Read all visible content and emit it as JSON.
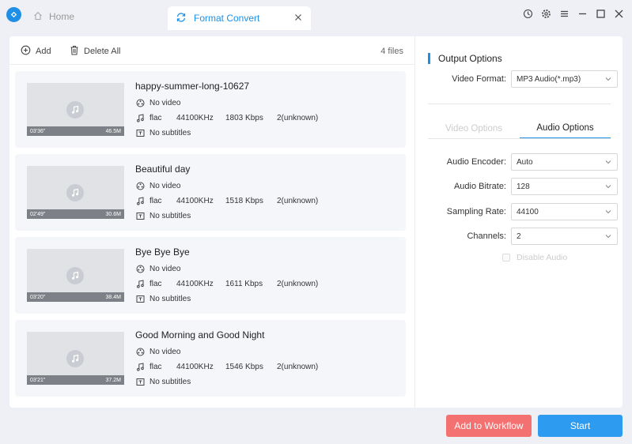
{
  "titlebar": {
    "home_label": "Home",
    "active_tab_label": "Format Convert"
  },
  "toolbar": {
    "add_label": "Add",
    "delete_all_label": "Delete All",
    "files_count": "4 files"
  },
  "files": [
    {
      "name": "happy-summer-long-10627",
      "duration": "03'36\"",
      "size": "46.5M",
      "video": "No video",
      "codec": "flac",
      "sample_rate": "44100KHz",
      "bitrate": "1803 Kbps",
      "channels": "2(unknown)",
      "subtitles": "No subtitles"
    },
    {
      "name": "Beautiful day",
      "duration": "02'49\"",
      "size": "30.6M",
      "video": "No video",
      "codec": "flac",
      "sample_rate": "44100KHz",
      "bitrate": "1518 Kbps",
      "channels": "2(unknown)",
      "subtitles": "No subtitles"
    },
    {
      "name": "Bye Bye Bye",
      "duration": "03'20\"",
      "size": "38.4M",
      "video": "No video",
      "codec": "flac",
      "sample_rate": "44100KHz",
      "bitrate": "1611 Kbps",
      "channels": "2(unknown)",
      "subtitles": "No subtitles"
    },
    {
      "name": "Good Morning and Good Night",
      "duration": "03'21\"",
      "size": "37.2M",
      "video": "No video",
      "codec": "flac",
      "sample_rate": "44100KHz",
      "bitrate": "1546 Kbps",
      "channels": "2(unknown)",
      "subtitles": "No subtitles"
    }
  ],
  "output": {
    "title": "Output Options",
    "video_format_label": "Video Format:",
    "video_format_value": "MP3 Audio(*.mp3)",
    "tabs": {
      "video": "Video Options",
      "audio": "Audio Options"
    },
    "audio_encoder_label": "Audio Encoder:",
    "audio_encoder_value": "Auto",
    "audio_bitrate_label": "Audio Bitrate:",
    "audio_bitrate_value": "128",
    "sampling_rate_label": "Sampling Rate:",
    "sampling_rate_value": "44100",
    "channels_label": "Channels:",
    "channels_value": "2",
    "disable_audio_label": "Disable Audio"
  },
  "actions": {
    "add_to_workflow": "Add to Workflow",
    "start": "Start"
  },
  "colors": {
    "accent": "#1f8fe6",
    "workflow_button": "#f47171",
    "start_button": "#2d9bf0"
  }
}
